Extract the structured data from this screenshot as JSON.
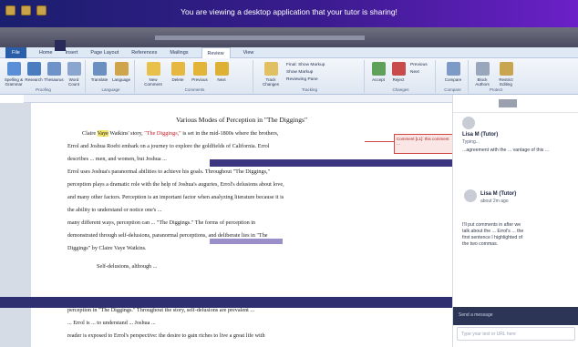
{
  "banner": {
    "text": "You are viewing a desktop application that your tutor is sharing!"
  },
  "ribbon": {
    "tabs": [
      "File",
      "Home",
      "Insert",
      "Page Layout",
      "References",
      "Mailings",
      "Review",
      "View"
    ],
    "active_tab": "Review",
    "groups": [
      {
        "label": "Proofing",
        "buttons": [
          "Spelling & Grammar",
          "Research",
          "Thesaurus",
          "Word Count"
        ]
      },
      {
        "label": "Language",
        "buttons": [
          "Translate",
          "Language"
        ]
      },
      {
        "label": "Comments",
        "buttons": [
          "New Comment",
          "Delete",
          "Previous",
          "Next"
        ]
      },
      {
        "label": "Tracking",
        "buttons": [
          "Track Changes",
          "Final: Show Markup",
          "Show Markup",
          "Reviewing Pane"
        ]
      },
      {
        "label": "Changes",
        "buttons": [
          "Accept",
          "Reject",
          "Previous",
          "Next"
        ]
      },
      {
        "label": "Compare",
        "buttons": [
          "Compare"
        ]
      },
      {
        "label": "Protect",
        "buttons": [
          "Block Authors",
          "Restrict Editing"
        ]
      }
    ]
  },
  "document": {
    "title": "Various Modes of Perception in \"The Diggings\"",
    "lines": [
      {
        "pre": "Claire ",
        "hl": "Vaye",
        "mid": " Watkins' story, ",
        "red": "\"The Diggings,\"",
        "post": " is set in the mid-1800s where the brothers,"
      },
      {
        "pre": "Errol and Joshua Roebi embark on a journey to explore the goldfields of California. Errol",
        "hl": "",
        "mid": "",
        "red": "",
        "post": ""
      },
      {
        "pre": "describes ... men, and women, but Joshua ...",
        "hl": "",
        "mid": "",
        "red": "",
        "post": ""
      },
      {
        "pre": "Errol uses Joshua's paranormal abilities to achieve his goals. Throughout \"The Diggings,\"",
        "hl": "",
        "mid": "",
        "red": "",
        "post": ""
      },
      {
        "pre": "perception plays a dramatic role with the help of Joshua's auguries, Errol's delusions about love,",
        "hl": "",
        "mid": "",
        "red": "",
        "post": ""
      },
      {
        "pre": "and many other factors. Perception is an important factor when analyzing literature because it is",
        "hl": "",
        "mid": "",
        "red": "",
        "post": ""
      },
      {
        "pre": "the ability to understand or notice one's ...",
        "hl": "",
        "mid": "",
        "red": "",
        "post": ""
      },
      {
        "pre": "many different ways, perception can ... \"The Diggings.\" The forms of perception in",
        "hl": "",
        "mid": "",
        "red": "",
        "post": ""
      },
      {
        "pre": "demonstrated through self-delusions, paranormal perceptions, and deliberate lies in \"The",
        "hl": "",
        "mid": "",
        "red": "",
        "post": ""
      },
      {
        "pre": "Diggings\" by Claire Vaye Watkins.",
        "hl": "",
        "mid": "",
        "red": "",
        "post": ""
      },
      {
        "pre": "Self-delusions, although ...",
        "hl": "",
        "mid": "",
        "red": "",
        "post": ""
      },
      {
        "pre": "perception in \"The Diggings.\" Throughout the story, self-delusions are prevalent ...",
        "hl": "",
        "mid": "",
        "red": "",
        "post": ""
      },
      {
        "pre": "... Errol is ... to understand ... Joshua ...",
        "hl": "",
        "mid": "",
        "red": "",
        "post": ""
      },
      {
        "pre": "reader is exposed to Errol's perspective: the desire to gain riches to live a great life with",
        "hl": "",
        "mid": "",
        "red": "",
        "post": ""
      }
    ],
    "comment": "Comment [L1]: this comment ..."
  },
  "chat": {
    "header_avatar_label": "",
    "messages": [
      {
        "name": "Lisa M (Tutor)",
        "sub": "Typing...",
        "text": "...agreement with the ... vantage of this ..."
      },
      {
        "name": "Lisa M (Tutor)",
        "sub": "about 2m ago",
        "text": "I'll put comments in after we talk about the ... Errol's ... the first sentence I highlighted of the two commas."
      }
    ],
    "input_label": "Send a message",
    "input_placeholder": "Type your text or URL here"
  }
}
